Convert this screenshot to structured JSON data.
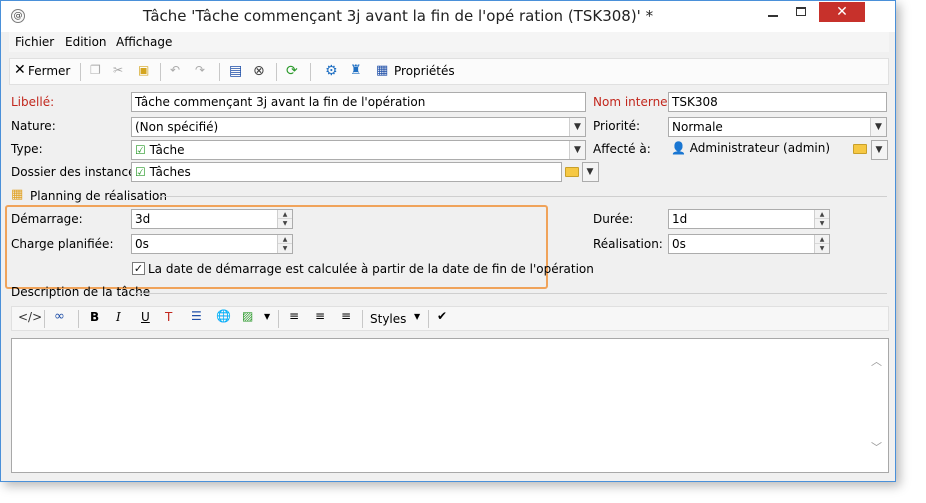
{
  "window": {
    "title": "Tâche 'Tâche commençant 3j avant la fin de l'opé ration (TSK308)' *",
    "app_icon": "@",
    "accent_color": "#c7312b"
  },
  "menu": [
    "Fichier",
    "Edition",
    "Affichage"
  ],
  "toolbar": {
    "close_label": "Fermer",
    "properties_label": "Propriétés",
    "styles_label": "Styles"
  },
  "form": {
    "libelle": {
      "label": "Libellé:",
      "value": "Tâche commençant 3j avant la fin de l'opération"
    },
    "nom_interne": {
      "label": "Nom interne:",
      "value": "TSK308"
    },
    "nature": {
      "label": "Nature:",
      "value": "(Non spécifié)"
    },
    "priorite": {
      "label": "Priorité:",
      "value": "Normale"
    },
    "type": {
      "label": "Type:",
      "value": "Tâche"
    },
    "affecte": {
      "label": "Affecté à:",
      "value": "Administrateur (admin)"
    },
    "dossier": {
      "label": "Dossier des instances:",
      "value": "Tâches"
    }
  },
  "planning": {
    "title": "Planning de réalisation",
    "demarrage": {
      "label": "Démarrage:",
      "value": "3d"
    },
    "charge": {
      "label": "Charge planifiée:",
      "value": "0s"
    },
    "duree": {
      "label": "Durée:",
      "value": "1d"
    },
    "realisation": {
      "label": "Réalisation:",
      "value": "0s"
    },
    "checkbox_label": "La date de démarrage est calculée à partir de la date de fin de l'opération",
    "checkbox_checked": true
  },
  "description": {
    "title": "Description de la tâche"
  }
}
